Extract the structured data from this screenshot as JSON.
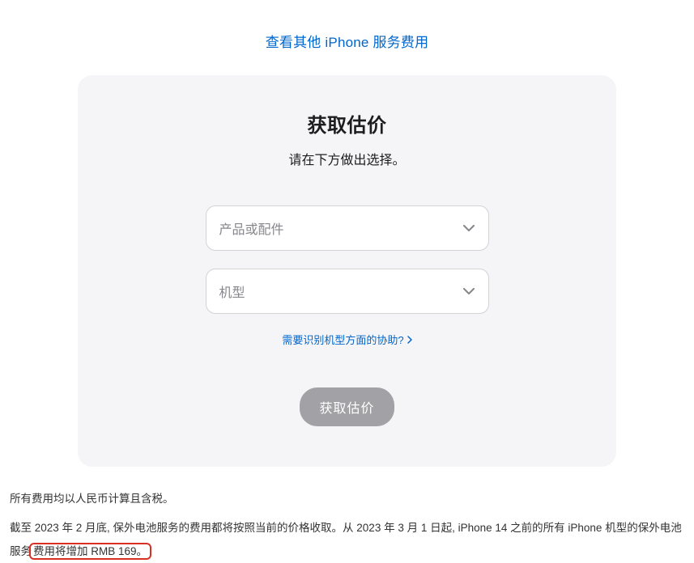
{
  "topLink": {
    "label": "查看其他 iPhone 服务费用"
  },
  "card": {
    "title": "获取估价",
    "subtitle": "请在下方做出选择。",
    "select1": {
      "placeholder": "产品或配件"
    },
    "select2": {
      "placeholder": "机型"
    },
    "helpLink": {
      "label": "需要识别机型方面的协助?"
    },
    "submit": {
      "label": "获取估价"
    }
  },
  "footer": {
    "line1": "所有费用均以人民币计算且含税。",
    "line2_part1": "截至 2023 年 2 月底, 保外电池服务的费用都将按照当前的价格收取。从 2023 年 3 月 1 日起, iPhone 14 之前的所有 iPhone 机型的保外电池服务",
    "line2_highlight": "费用将增加 RMB 169。"
  }
}
